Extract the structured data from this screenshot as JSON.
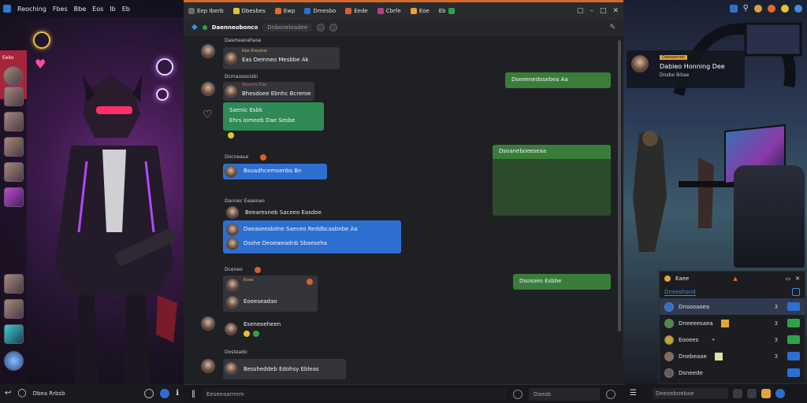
{
  "left": {
    "topbar_menus": [
      "Reoching",
      "Fbes",
      "Bbe",
      "Eos",
      "Ib",
      "Eb"
    ],
    "rail_selected_label": "Eeko",
    "bottom_label": "Dbea Rrbsb"
  },
  "chat": {
    "tabs": [
      {
        "label": "Eep Iberb",
        "color": "#6a6a70"
      },
      {
        "label": "Dbesbes",
        "color": "#e3c23a"
      },
      {
        "label": "Ewp",
        "color": "#e36a2a"
      },
      {
        "label": "Dmesbo",
        "color": "#2d6fd1"
      },
      {
        "label": "Eede",
        "color": "#d6602c"
      },
      {
        "label": "Cbrfe",
        "color": "#c03a8a"
      },
      {
        "label": "Eoe",
        "color": "#e3a53a"
      },
      {
        "label": "Eb",
        "color": "#2ea24a"
      }
    ],
    "header_title": "Daenneobonco",
    "header_sub": "Dnboneleadee",
    "messages": [
      {
        "name": "Dasmeanehase",
        "sub": "Rbe Ereodnb",
        "text": "Eas Demneo Mesbbe Ak"
      },
      {
        "name": "Dcmaosonisbi",
        "sub": "Sheorhs Ede",
        "text": "Bhesdoee Ebnhc Bcreroe"
      },
      {
        "name": "",
        "sub": "",
        "text": "Saenic Esbk",
        "text2": "Ehrs Iomeeb Dae Sesbe"
      },
      {
        "name": "Docneaue",
        "sub": "",
        "text": "Bsuadhcemoenbs Bn"
      },
      {
        "name": "Dannec Eeaeneo",
        "sub": "",
        "text": "Beearesneb Saceeo Easdoe"
      },
      {
        "name": "",
        "sub": "",
        "text": "Daeaseesbdne Saeceo Reddbcasbnbe Aa",
        "text2": "Dsshe Deoeweadnb Sbaeseha"
      },
      {
        "name": "Dceneo",
        "sub": "Eoee",
        "text": "Eoeeseadao"
      },
      {
        "name": "Deeenree",
        "sub": "",
        "text": "Eseneoeheen"
      },
      {
        "name": "Dosteado",
        "sub": "",
        "text": "Bessheddeb Edohsy Ebleas"
      }
    ],
    "outgoing": [
      {
        "text": "Dseeenedosebea Aa"
      },
      {
        "text": "Dsoaneboeeseaa"
      },
      {
        "text": "Dsosoeo Esbbe"
      }
    ],
    "compose_placeholder": "Eeseeaamnm",
    "search_placeholder": "Daesb"
  },
  "right": {
    "notif_tag": "Deeeeenee",
    "notif_title": "Dabieo Honning Dee",
    "notif_sub": "Dnsbe Ikbae",
    "friends_title": "Eaee",
    "friends_sub": "Dneeohsnd",
    "friends": [
      {
        "name": "Dnsooaoea",
        "count": "3",
        "action": "blue"
      },
      {
        "name": "Dneeeesaea",
        "count": "3",
        "action": "green"
      },
      {
        "name": "Eooees",
        "count": "3",
        "action": "green"
      },
      {
        "name": "Dnebeaae",
        "count": "3",
        "action": "blue"
      },
      {
        "name": "Dsneede",
        "count": "",
        "action": "blue"
      }
    ],
    "bottom_search": "Deeoeboebae"
  }
}
